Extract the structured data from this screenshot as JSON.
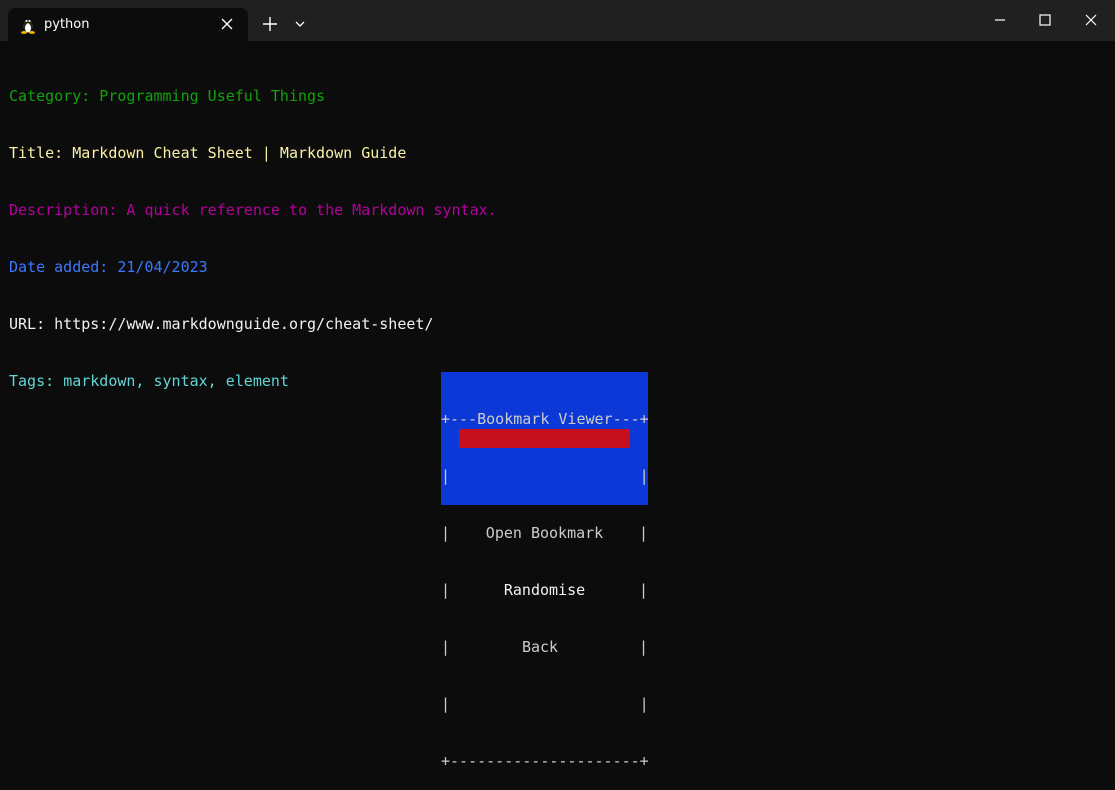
{
  "window": {
    "tab_title": "python",
    "tab_icon": "linux-tux-icon",
    "controls": [
      "minimize-icon",
      "maximize-icon",
      "close-icon"
    ]
  },
  "colors": {
    "green": "#13a10e",
    "yellow": "#f9f1a5",
    "magenta": "#b4009e",
    "blue": "#3b78ff",
    "white": "#f2f2f2",
    "cyan": "#61d6d6",
    "dialog_bg": "#0c38d7",
    "selected_bg": "#c50f1f"
  },
  "bookmark": {
    "category": "Category: Programming Useful Things",
    "title": "Title: Markdown Cheat Sheet | Markdown Guide",
    "description": "Description: A quick reference to the Markdown syntax.",
    "date": "Date added: 21/04/2023",
    "url": "URL: https://www.markdownguide.org/cheat-sheet/",
    "tags_label": "Tags:",
    "tags": "markdown, syntax, element"
  },
  "dialog": {
    "top_border": "+---Bookmark Viewer---+",
    "blank_line": "|                     |",
    "bottom_border": "+---------------------+",
    "side": "|",
    "items": [
      "Open Bookmark",
      "Randomise",
      "Back"
    ],
    "selected_index": 1
  }
}
